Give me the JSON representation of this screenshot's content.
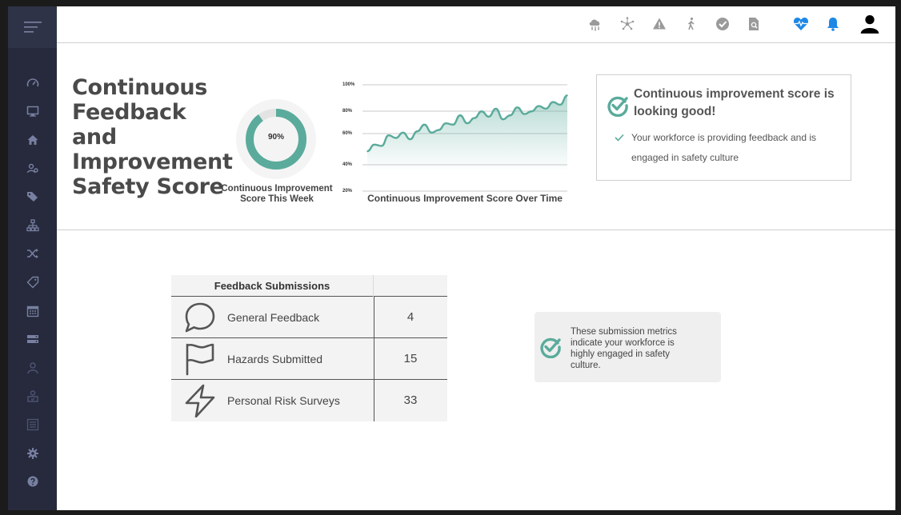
{
  "sidebar": {
    "items": [
      {
        "icon": "speedometer-icon"
      },
      {
        "icon": "monitor-icon"
      },
      {
        "icon": "home-icon"
      },
      {
        "icon": "users-gear-icon"
      },
      {
        "icon": "tags-icon"
      },
      {
        "icon": "sitemap-icon"
      },
      {
        "icon": "shuffle-icon"
      },
      {
        "icon": "tag-outline-icon"
      },
      {
        "icon": "calendar-icon"
      },
      {
        "icon": "server-icon"
      },
      {
        "icon": "user-icon"
      },
      {
        "icon": "user-shield-icon"
      },
      {
        "icon": "list-icon"
      },
      {
        "icon": "gear-icon"
      },
      {
        "icon": "help-icon"
      }
    ]
  },
  "topbar": {
    "icons": [
      "cloud-network-icon",
      "network-hub-icon",
      "warning-icon",
      "walking-person-icon",
      "check-circle-icon",
      "document-search-icon",
      "heartbeat-icon",
      "bell-icon",
      "user-profile-icon"
    ]
  },
  "hero": {
    "title": "Continuous Feedback and Improvement Safety Score",
    "donut": {
      "value_label": "90%",
      "fraction": 0.9,
      "caption": "Continuous Improvement Score This Week"
    },
    "line_chart_caption": "Continuous Improvement Score Over Time"
  },
  "chart_data": {
    "type": "area",
    "title": "Continuous Improvement Score Over Time",
    "y_ticks": [
      "100%",
      "80%",
      "60%",
      "40%",
      "20%"
    ],
    "ylim": [
      20,
      100
    ],
    "series": [
      {
        "values": [
          50,
          55,
          54,
          62,
          60,
          64,
          59,
          65,
          70,
          64,
          66,
          71,
          70,
          77,
          71,
          75,
          80,
          76,
          82,
          74,
          77,
          83,
          78,
          80,
          84,
          82,
          87,
          85,
          92
        ]
      }
    ]
  },
  "status_card": {
    "title": "Continuous improvement score is looking good!",
    "message": "Your workforce is providing feedback and is engaged in safety culture"
  },
  "submissions": {
    "header": "Feedback Submissions",
    "rows": [
      {
        "icon": "speech-bubble-icon",
        "label": "General Feedback",
        "value": "4"
      },
      {
        "icon": "flag-icon",
        "label": "Hazards Submitted",
        "value": "15"
      },
      {
        "icon": "lightning-icon",
        "label": "Personal Risk Surveys",
        "value": "33"
      }
    ]
  },
  "note_card": {
    "text": "These submission metrics indicate your workforce is highly engaged in safety culture."
  },
  "colors": {
    "accent": "#5aab9b",
    "sidebar": "#272a3d",
    "heart_blue": "#1e88e5"
  }
}
